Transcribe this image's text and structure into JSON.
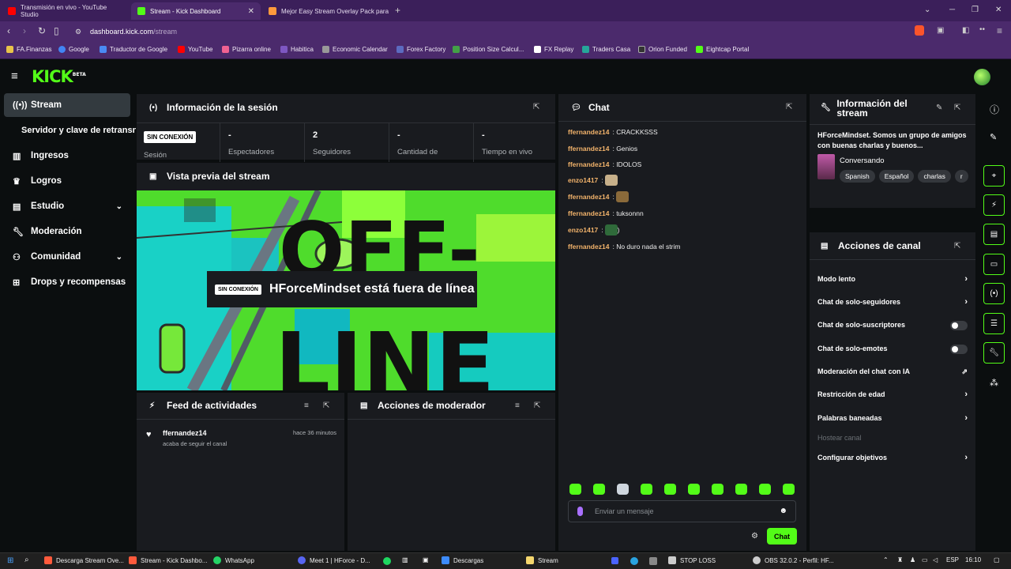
{
  "browser": {
    "tabs": [
      {
        "title": "Transmisión en vivo - YouTube Studio",
        "color": "#ff0000"
      },
      {
        "title": "Stream - Kick Dashboard",
        "color": "#53fc18"
      },
      {
        "title": "Mejor Easy Stream Overlay Pack para",
        "color": "#ff9a3c"
      }
    ],
    "url_host": "dashboard.kick.com",
    "url_path": "/stream",
    "bookmarks": [
      {
        "label": "FA.Finanzas",
        "color": "#e8c34a"
      },
      {
        "label": "Google",
        "color": "#4285f4"
      },
      {
        "label": "Traductor de Google",
        "color": "#4a8af4"
      },
      {
        "label": "YouTube",
        "color": "#ff0000"
      },
      {
        "label": "Pizarra online",
        "color": "#f06292"
      },
      {
        "label": "Habitica",
        "color": "#7e57c2"
      },
      {
        "label": "Economic Calendar",
        "color": "#999999"
      },
      {
        "label": "Forex Factory",
        "color": "#5c6bc0"
      },
      {
        "label": "Position Size Calcul...",
        "color": "#43a047"
      },
      {
        "label": "FX Replay",
        "color": "#ffffff"
      },
      {
        "label": "Traders Casa",
        "color": "#26a69a"
      },
      {
        "label": "Orion Funded",
        "color": "#333333"
      },
      {
        "label": "Eightcap Portal",
        "color": "#53fc18"
      }
    ]
  },
  "header": {
    "logo": "KICK",
    "logo_sup": "BETA"
  },
  "sidebar": {
    "items": [
      {
        "label": "Stream",
        "icon": "broadcast-icon"
      },
      {
        "label": "Servidor y clave de retransn",
        "icon": ""
      },
      {
        "label": "Ingresos",
        "icon": "chart-icon"
      },
      {
        "label": "Logros",
        "icon": "trophy-icon"
      },
      {
        "label": "Estudio",
        "icon": "studio-icon"
      },
      {
        "label": "Moderación",
        "icon": "wrench-icon"
      },
      {
        "label": "Comunidad",
        "icon": "community-icon"
      },
      {
        "label": "Drops y recompensas",
        "icon": "drops-icon"
      }
    ]
  },
  "session": {
    "title": "Información de la sesión",
    "badge": "SIN CONEXIÓN",
    "session_label": "Sesión",
    "stats": [
      {
        "value": "-",
        "label": "Espectadores"
      },
      {
        "value": "2",
        "label": "Seguidores"
      },
      {
        "value": "-",
        "label": "Cantidad de"
      },
      {
        "value": "-",
        "label": "Tiempo en vivo"
      }
    ]
  },
  "preview": {
    "title": "Vista previa del stream",
    "badge": "SIN CONEXIÓN",
    "message": "HForceMindset está fuera de línea",
    "bg_word_top": "OFF-",
    "bg_word_bottom": "LINE"
  },
  "activity": {
    "title": "Feed de actividades",
    "items": [
      {
        "user": "ffernandez14",
        "text": "acaba de seguir el canal",
        "time": "hace 36 minutos"
      }
    ]
  },
  "mod_actions": {
    "title": "Acciones de moderador"
  },
  "chat": {
    "title": "Chat",
    "messages": [
      {
        "user": "ffernandez14",
        "text": "CRACKKSSS",
        "color": "#f2b36b",
        "emote": ""
      },
      {
        "user": "ffernandez14",
        "text": "Genios",
        "color": "#f2b36b",
        "emote": ""
      },
      {
        "user": "ffernandez14",
        "text": "IDOLOS",
        "color": "#f2b36b",
        "emote": ""
      },
      {
        "user": "enzo1417",
        "text": "",
        "color": "#f2b36b",
        "emote": "#c7b08a"
      },
      {
        "user": "ffernandez14",
        "text": "",
        "color": "#f2b36b",
        "emote": "#8a6a3a"
      },
      {
        "user": "ffernandez14",
        "text": "tuksonnn",
        "color": "#f2b36b",
        "emote": ""
      },
      {
        "user": "enzo1417",
        "text": ")",
        "color": "#f2b36b",
        "emote": "#2f6a3a"
      },
      {
        "user": "ffernandez14",
        "text": "No duro nada el strim",
        "color": "#f2b36b",
        "emote": ""
      }
    ],
    "input_placeholder": "Enviar un mensaje",
    "send_label": "Chat"
  },
  "stream_info": {
    "title": "Información del stream",
    "description": "HForceMindset. Somos un grupo de amigos con buenas charlas y buenos...",
    "category": "Conversando",
    "tags": [
      "Spanish",
      "Español",
      "charlas",
      "r"
    ]
  },
  "channel_actions": {
    "title": "Acciones de canal",
    "items": [
      {
        "label": "Modo lento",
        "control": "chevron"
      },
      {
        "label": "Chat de solo-seguidores",
        "control": "chevron"
      },
      {
        "label": "Chat de solo-suscriptores",
        "control": "toggle"
      },
      {
        "label": "Chat de solo-emotes",
        "control": "toggle"
      },
      {
        "label": "Moderación del chat con IA",
        "control": "external"
      },
      {
        "label": "Restricción de edad",
        "control": "chevron"
      },
      {
        "label": "Palabras baneadas",
        "control": "chevron"
      },
      {
        "label": "Hostear canal",
        "control": "none"
      },
      {
        "label": "Configurar objetivos",
        "control": "chevron"
      }
    ]
  },
  "taskbar": {
    "apps": [
      {
        "label": "Descarga Stream Ove...",
        "color": "#ff5a3c"
      },
      {
        "label": "Stream - Kick Dashbo...",
        "color": "#ff5a3c"
      },
      {
        "label": "WhatsApp",
        "color": "#25d366"
      },
      {
        "label": "Meet 1 | HForce - D...",
        "color": "#5865f2"
      },
      {
        "label": "Descargas",
        "color": "#3d8bfd"
      },
      {
        "label": "Stream",
        "color": "#f5d76e"
      },
      {
        "label": "STOP LOSS",
        "color": "#cccccc"
      },
      {
        "label": "OBS 32.0.2 - Perfil: HF...",
        "color": "#cccccc"
      }
    ],
    "lang": "ESP",
    "time": "16:10"
  },
  "colors": {
    "accent": "#53fc18",
    "panel": "#191b1f",
    "bg": "#0b0e0f"
  }
}
